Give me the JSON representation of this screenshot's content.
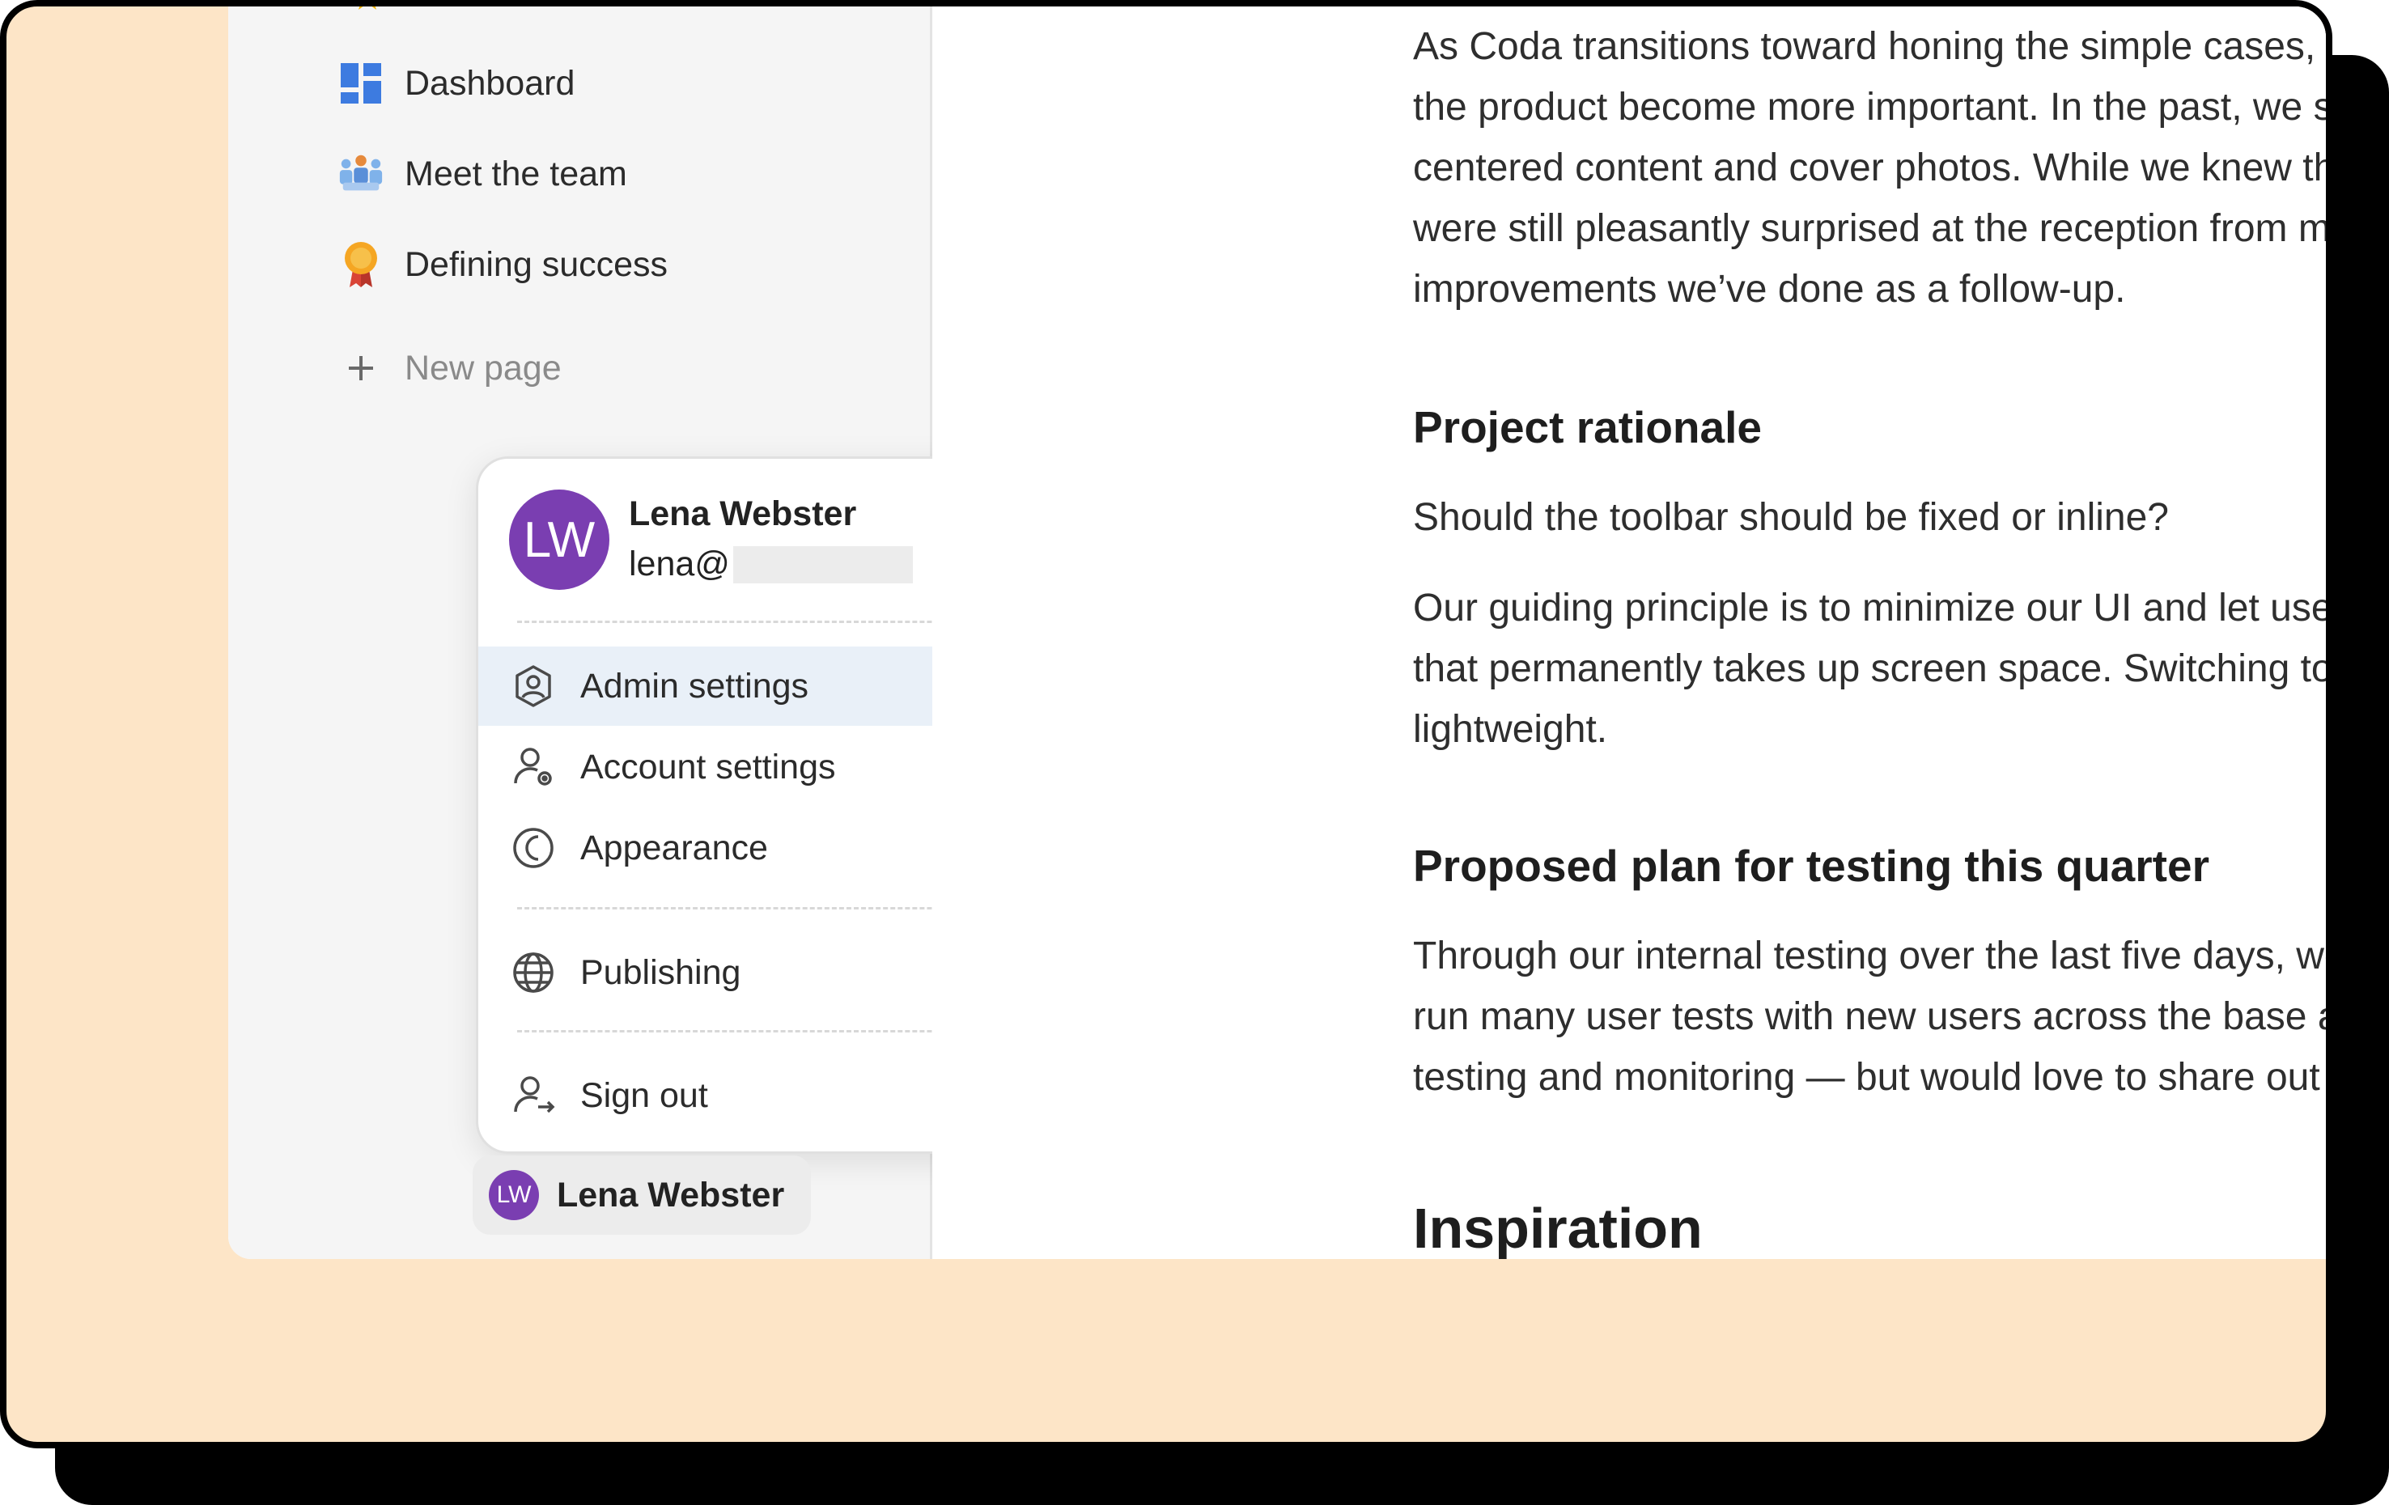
{
  "sidebar": {
    "items": [
      {
        "label": "Dashboard",
        "icon": "dashboard-icon"
      },
      {
        "label": "Meet the team",
        "icon": "team-icon"
      },
      {
        "label": "Defining success",
        "icon": "medal-icon"
      }
    ],
    "new_page_label": "New page"
  },
  "account_menu": {
    "user_name": "Lena Webster",
    "user_initials": "LW",
    "email_prefix": "lena@",
    "items": [
      {
        "label": "Admin settings",
        "icon": "admin-shield-icon"
      },
      {
        "label": "Account settings",
        "icon": "account-settings-icon"
      },
      {
        "label": "Appearance",
        "icon": "appearance-icon",
        "has_submenu": true
      },
      {
        "label": "Publishing",
        "icon": "globe-icon",
        "has_submenu": true
      },
      {
        "label": "Sign out",
        "icon": "sign-out-icon"
      }
    ]
  },
  "user_chip": {
    "initials": "LW",
    "name": "Lena Webster"
  },
  "document": {
    "intro_lines": [
      "As Coda transitions toward honing the simple cases, things lik",
      "the product become more important. In the past, we saw evid",
      "centered content and cover photos. While we knew those fea",
      "were still pleasantly surprised at the reception from makers ar",
      "improvements we’ve done as a follow-up."
    ],
    "h_rationale": "Project rationale",
    "question": "Should the toolbar should be fixed or inline?",
    "principle_lines": [
      "Our guiding principle is to minimize our UI and let user conten",
      "that permanently takes up screen space. Switching to the inlin",
      "lightweight."
    ],
    "h_plan": "Proposed plan for testing this quarter",
    "plan_lines": [
      "Through our internal testing over the last five days, we have r",
      "run many user tests with new users across the base and inline",
      "testing and monitoring — but would love to share out what we"
    ],
    "h_inspiration": "Inspiration"
  },
  "colors": {
    "frame_background": "#fde5c7",
    "avatar_purple": "#7a3eb1",
    "menu_hover": "#e9f0f8"
  }
}
